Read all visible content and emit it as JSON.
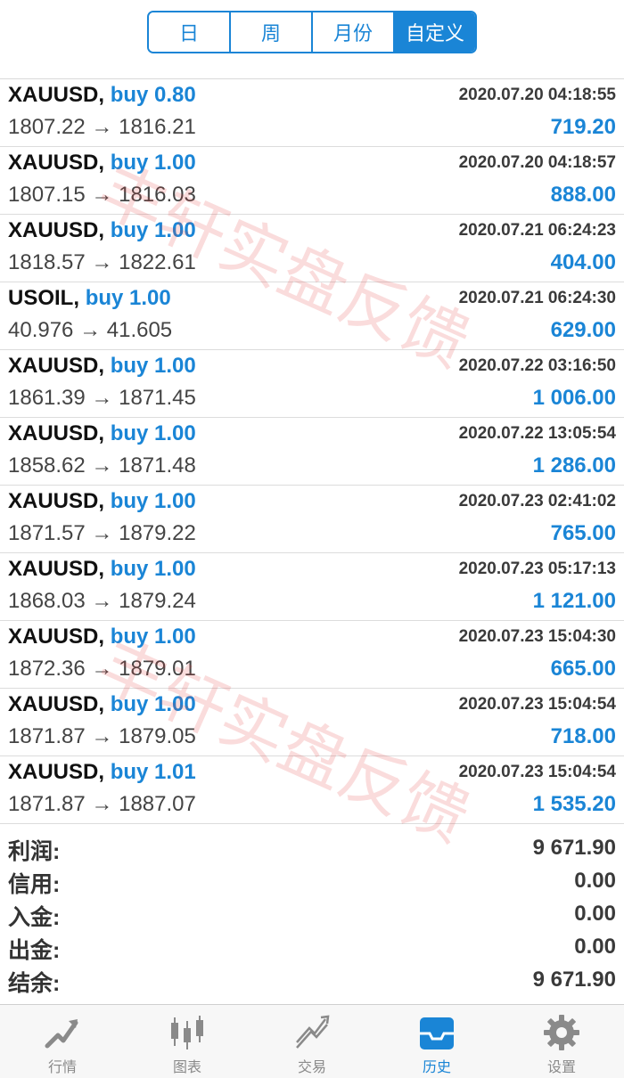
{
  "header": {
    "tabs": [
      {
        "label": "日",
        "active": false
      },
      {
        "label": "周",
        "active": false
      },
      {
        "label": "月份",
        "active": false
      },
      {
        "label": "自定义",
        "active": true
      }
    ]
  },
  "deals": [
    {
      "symbol": "XAUUSD,",
      "side": "buy 0.80",
      "date": "2020.07.20 04:18:55",
      "prices": "1807.22 → 1816.21",
      "profit": "719.20"
    },
    {
      "symbol": "XAUUSD,",
      "side": "buy 1.00",
      "date": "2020.07.20 04:18:57",
      "prices": "1807.15 → 1816.03",
      "profit": "888.00"
    },
    {
      "symbol": "XAUUSD,",
      "side": "buy 1.00",
      "date": "2020.07.21 06:24:23",
      "prices": "1818.57 → 1822.61",
      "profit": "404.00"
    },
    {
      "symbol": "USOIL,",
      "side": "buy 1.00",
      "date": "2020.07.21 06:24:30",
      "prices": "40.976 → 41.605",
      "profit": "629.00"
    },
    {
      "symbol": "XAUUSD,",
      "side": "buy 1.00",
      "date": "2020.07.22 03:16:50",
      "prices": "1861.39 → 1871.45",
      "profit": "1 006.00"
    },
    {
      "symbol": "XAUUSD,",
      "side": "buy 1.00",
      "date": "2020.07.22 13:05:54",
      "prices": "1858.62 → 1871.48",
      "profit": "1 286.00"
    },
    {
      "symbol": "XAUUSD,",
      "side": "buy 1.00",
      "date": "2020.07.23 02:41:02",
      "prices": "1871.57 → 1879.22",
      "profit": "765.00"
    },
    {
      "symbol": "XAUUSD,",
      "side": "buy 1.00",
      "date": "2020.07.23 05:17:13",
      "prices": "1868.03 → 1879.24",
      "profit": "1 121.00"
    },
    {
      "symbol": "XAUUSD,",
      "side": "buy 1.00",
      "date": "2020.07.23 15:04:30",
      "prices": "1872.36 → 1879.01",
      "profit": "665.00"
    },
    {
      "symbol": "XAUUSD,",
      "side": "buy 1.00",
      "date": "2020.07.23 15:04:54",
      "prices": "1871.87 → 1879.05",
      "profit": "718.00"
    },
    {
      "symbol": "XAUUSD,",
      "side": "buy 1.01",
      "date": "2020.07.23 15:04:54",
      "prices": "1871.87 → 1887.07",
      "profit": "1 535.20"
    }
  ],
  "summary": [
    {
      "label": "利润:",
      "value": "9 671.90"
    },
    {
      "label": "信用:",
      "value": "0.00"
    },
    {
      "label": "入金:",
      "value": "0.00"
    },
    {
      "label": "出金:",
      "value": "0.00"
    },
    {
      "label": "结余:",
      "value": "9 671.90"
    }
  ],
  "tabbar": [
    {
      "label": "行情",
      "icon": "quotes-icon",
      "active": false
    },
    {
      "label": "图表",
      "icon": "chart-icon",
      "active": false
    },
    {
      "label": "交易",
      "icon": "trade-icon",
      "active": false
    },
    {
      "label": "历史",
      "icon": "history-icon",
      "active": true
    },
    {
      "label": "设置",
      "icon": "gear-icon",
      "active": false
    }
  ],
  "watermark": "丰轩实盘反馈",
  "colors": {
    "accent": "#1a85d6",
    "watermark": "#e23b3b"
  }
}
